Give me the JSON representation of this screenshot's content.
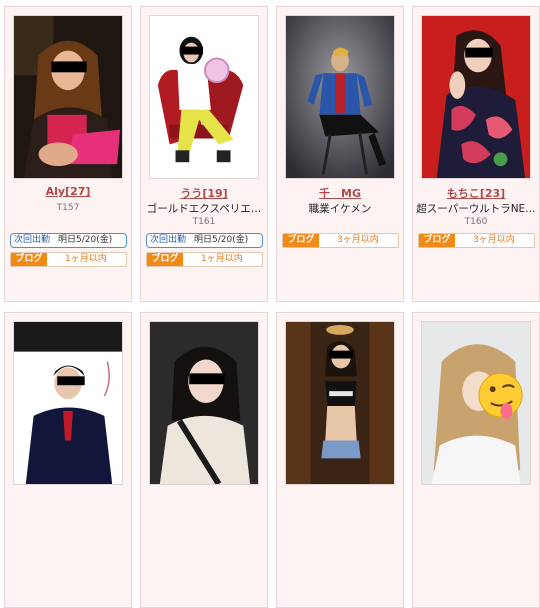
{
  "colors": {
    "card_bg": "#fdf3f3",
    "name": "#b24a4a",
    "blog_tag": "#f28a16",
    "next_border": "#4d8fd0"
  },
  "row1": [
    {
      "name": "Aly",
      "age": "[27]",
      "catch": "",
      "height": "T157",
      "next_label": "次回出勤",
      "next_value": "明日5/20(金)",
      "blog_label": "ブログ",
      "blog_value": "1ヶ月以内"
    },
    {
      "name": "うう",
      "age": "[19]",
      "catch": "ゴールドエクスペリエ…",
      "height": "T161",
      "next_label": "次回出勤",
      "next_value": "明日5/20(金)",
      "blog_label": "ブログ",
      "blog_value": "1ヶ月以内"
    },
    {
      "name": "千　MG",
      "age": "",
      "catch": "職業イケメン",
      "height": "",
      "blog_label": "ブログ",
      "blog_value": "3ヶ月以内"
    },
    {
      "name": "もちこ",
      "age": "[23]",
      "catch": "超スーパーウルトラNE…",
      "height": "T160",
      "blog_label": "ブログ",
      "blog_value": "3ヶ月以内"
    }
  ]
}
